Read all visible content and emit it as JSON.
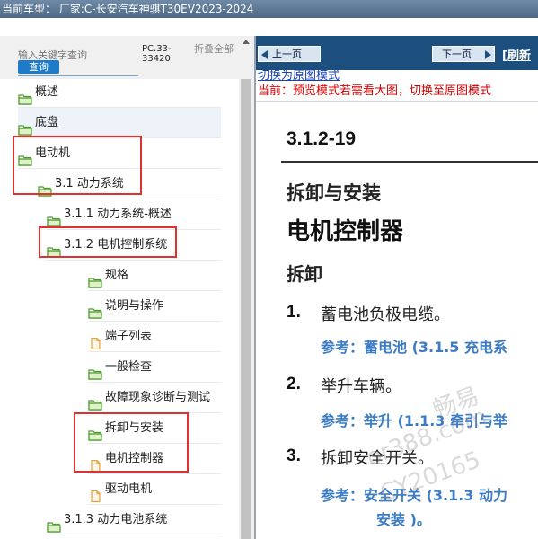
{
  "header": {
    "current_model": "当前车型：  厂家:C-长安汽车神骐T30EV2023-2024"
  },
  "sidebar": {
    "search_placeholder": "输入关键字查询",
    "search_button": "查询",
    "doc_code": "PC.33-33420",
    "collapse_all": "折叠全部",
    "tree": [
      {
        "label": "概述",
        "icon": "folder-open-icon"
      },
      {
        "label": "底盘",
        "icon": "folder-open-icon"
      },
      {
        "label": "电动机",
        "icon": "folder-open-icon"
      },
      {
        "label": "3.1 动力系统",
        "icon": "folder-open-icon"
      },
      {
        "label": "3.1.1 动力系统-概述",
        "icon": "folder-open-icon"
      },
      {
        "label": "3.1.2 电机控制系统",
        "icon": "folder-open-icon"
      },
      {
        "label": "规格",
        "icon": "folder-open-icon"
      },
      {
        "label": "说明与操作",
        "icon": "folder-open-icon"
      },
      {
        "label": "端子列表",
        "icon": "document-icon"
      },
      {
        "label": "一般检查",
        "icon": "folder-open-icon"
      },
      {
        "label": "故障现象诊断与测试",
        "icon": "folder-open-icon"
      },
      {
        "label": "拆卸与安装",
        "icon": "folder-open-icon"
      },
      {
        "label": "电机控制器",
        "icon": "document-icon"
      },
      {
        "label": "驱动电机",
        "icon": "document-icon"
      },
      {
        "label": "3.1.3 动力电池系统",
        "icon": "folder-open-icon"
      }
    ]
  },
  "viewer": {
    "prev_label": "上一页",
    "next_label": "下一页",
    "refresh_label": "[刷新",
    "switch_link": "切换为原图模式",
    "preview_prefix": "当前：预览模式",
    "preview_suffix": "若需看大图，切换至原图模式"
  },
  "document": {
    "section_number": "3.1.2-19",
    "heading1": "拆卸与安装",
    "heading2": "电机控制器",
    "heading3": "拆卸",
    "steps": [
      {
        "num": "1.",
        "text": "蓄电池负极电缆。",
        "ref": "参考：蓄电池 (3.1.5 充电系"
      },
      {
        "num": "2.",
        "text": "举升车辆。",
        "ref": "参考：举升 (1.1.3 牵引与举"
      },
      {
        "num": "3.",
        "text": "拆卸安全开关。",
        "ref": "参考：安全开关 (3.1.3 动力",
        "ref2": "安装 )。"
      }
    ]
  },
  "watermark": {
    "line1": "畅易",
    "line2": "or388.com",
    "line3": "CY20165"
  }
}
